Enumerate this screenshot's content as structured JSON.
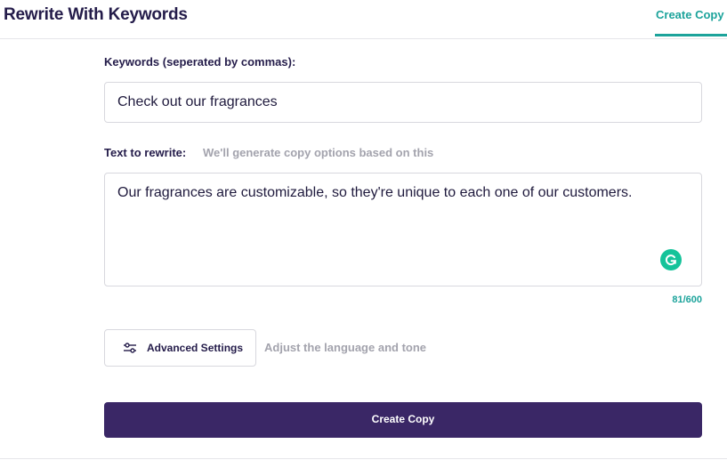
{
  "header": {
    "title": "Rewrite With Keywords",
    "tab_label": "Create Copy"
  },
  "keywords": {
    "label": "Keywords (seperated by commas):",
    "value": "Check out our fragrances"
  },
  "rewrite": {
    "label": "Text to rewrite:",
    "hint": "We'll generate copy options based on this",
    "value": "Our fragrances are customizable, so they're unique to each one of our customers.",
    "counter": "81/600",
    "grammarly_icon": "grammarly-icon"
  },
  "advanced": {
    "button_label": "Advanced Settings",
    "icon": "sliders-icon",
    "hint": "Adjust the language and tone"
  },
  "create": {
    "button_label": "Create Copy"
  },
  "colors": {
    "accent": "#1ca39b",
    "primary_button": "#3a2766",
    "heading": "#241c4a",
    "muted": "#a3a3ad",
    "grammarly": "#15c39a"
  }
}
